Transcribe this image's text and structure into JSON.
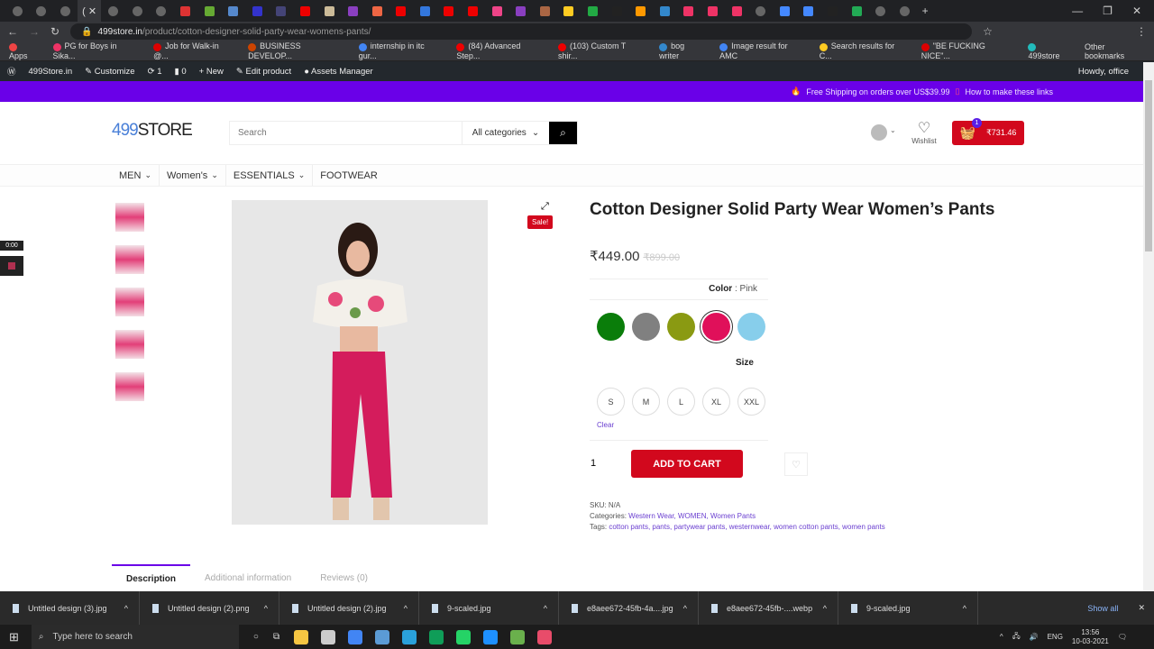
{
  "browser": {
    "tab_colors": [
      "#666",
      "#666",
      "#666",
      "#ddd",
      "#666",
      "#666",
      "#666",
      "#d33",
      "#6a3",
      "#58c",
      "#33c",
      "#447",
      "#e00",
      "#cb9",
      "#8a3fc0",
      "#e64",
      "#e00",
      "#37d",
      "#e00",
      "#e00",
      "#e48",
      "#8a3fc0",
      "#a64",
      "#fc2",
      "#2a4",
      "#222",
      "#f90",
      "#38c",
      "#e36",
      "#e36",
      "#e36",
      "#666",
      "#48f",
      "#48f",
      "#222",
      "#2a5",
      "#666",
      "#666"
    ],
    "active_tab_label": "( ✕",
    "new_tab": "+",
    "window_controls": [
      "—",
      "❐",
      "✕"
    ],
    "url_domain": "499store.in",
    "url_path": "/product/cotton-designer-solid-party-wear-womens-pants/",
    "bookmarks": [
      {
        "label": "Apps",
        "color": "#e44"
      },
      {
        "label": "PG for Boys in Sika...",
        "color": "#e36"
      },
      {
        "label": "Job for Walk-in @...",
        "color": "#d00"
      },
      {
        "label": "BUSINESS DEVELOP...",
        "color": "#c40"
      },
      {
        "label": "internship in itc gur...",
        "color": "#4285f4"
      },
      {
        "label": "(84) Advanced Step...",
        "color": "#e00"
      },
      {
        "label": "(103) Custom T shir...",
        "color": "#e00"
      },
      {
        "label": "bog writer",
        "color": "#38c"
      },
      {
        "label": "Image result for AMC",
        "color": "#4285f4"
      },
      {
        "label": "Search results for C...",
        "color": "#fc2"
      },
      {
        "label": "\"BE FUCKING NICE\"...",
        "color": "#d00"
      },
      {
        "label": "499store",
        "color": "#2bb"
      }
    ],
    "other_bookmarks": "Other bookmarks"
  },
  "wp_admin": {
    "items": [
      "499Store.in",
      "Customize",
      "1",
      "0",
      "New",
      "Edit product",
      "Assets Manager"
    ],
    "howdy": "Howdy, office"
  },
  "promo": {
    "shipping": "Free Shipping on orders over US$39.99",
    "links": "How to make these links"
  },
  "header": {
    "logo_num": "499",
    "logo_text": "STORE",
    "search_placeholder": "Search",
    "category": "All categories",
    "wishlist": "Wishlist",
    "cart_count": "1",
    "cart_total": "₹731.46"
  },
  "nav": [
    {
      "label": "MEN",
      "dropdown": true
    },
    {
      "label": "Women's",
      "dropdown": true
    },
    {
      "label": "ESSENTIALS",
      "dropdown": true
    },
    {
      "label": "FOOTWEAR",
      "dropdown": false
    }
  ],
  "product": {
    "sale_badge": "Sale!",
    "title": "Cotton Designer Solid Party Wear Women’s Pants",
    "price": "₹449.00",
    "regular_price": "₹899.00",
    "color_label": "Color",
    "color_value": "Pink",
    "colors": [
      "#0a7d0a",
      "#808080",
      "#8a9a12",
      "#e0105a",
      "#87ceeb"
    ],
    "selected_color_index": 3,
    "size_label": "Size",
    "sizes": [
      "S",
      "M",
      "L",
      "XL",
      "XXL"
    ],
    "clear": "Clear",
    "quantity": "1",
    "add_to_cart": "ADD TO CART",
    "sku_label": "SKU:",
    "sku": "N/A",
    "categories_label": "Categories:",
    "categories": "Western Wear, WOMEN, Women Pants",
    "tags_label": "Tags:",
    "tags": "cotton pants, pants, partywear pants, westernwear, women cotton pants, women pants"
  },
  "detail_tabs": [
    "Description",
    "Additional information",
    "Reviews (0)"
  ],
  "video_widget": {
    "time": "0:00"
  },
  "downloads": {
    "items": [
      "Untitled design (3).jpg",
      "Untitled design (2).png",
      "Untitled design (2).jpg",
      "9-scaled.jpg",
      "e8aee672-45fb-4a....jpg",
      "e8aee672-45fb-....webp",
      "9-scaled.jpg"
    ],
    "show_all": "Show all"
  },
  "taskbar": {
    "search_placeholder": "Type here to search",
    "apps": [
      "#f5c542",
      "#ccc",
      "#4285f4",
      "#5b9bd5",
      "#2aa1da",
      "#0f9d58",
      "#25d366",
      "#1e90ff",
      "#6ab04c",
      "#e84c6a"
    ],
    "lang": "ENG",
    "time": "13:56",
    "date": "10-03-2021"
  },
  "accent_color": "#6a00e8",
  "brand_red": "#d2081d"
}
